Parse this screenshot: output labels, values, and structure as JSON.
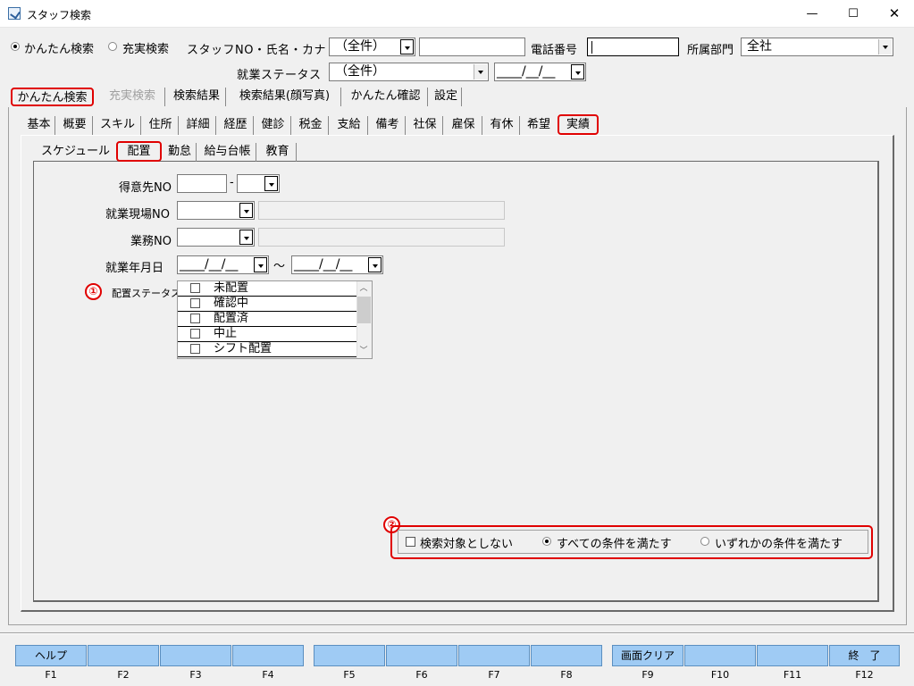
{
  "window": {
    "title": "スタッフ検索",
    "min": "—",
    "max": "☐",
    "close": "✕"
  },
  "search_mode": {
    "simple_label": "かんたん検索",
    "full_label": "充実検索",
    "selected": "simple"
  },
  "header": {
    "staff_label": "スタッフNO・氏名・カナ",
    "staff_select_value": "（全件）",
    "staff_text_value": "",
    "phone_label": "電話番号",
    "phone_value": "",
    "dept_label": "所属部門",
    "dept_value": "全社",
    "work_status_label": "就業ステータス",
    "work_status_value": "（全件）",
    "work_status_date": "____/__/__"
  },
  "main_tabs": [
    {
      "label": "かんたん検索",
      "highlighted": true
    },
    {
      "label": "充実検索",
      "disabled": true
    },
    {
      "label": "検索結果"
    },
    {
      "label": "検索結果(顔写真)"
    },
    {
      "label": "かんたん確認"
    },
    {
      "label": "設定"
    }
  ],
  "sub_tabs": [
    "基本",
    "概要",
    "スキル",
    "住所",
    "詳細",
    "経歴",
    "健診",
    "税金",
    "支給",
    "備考",
    "社保",
    "雇保",
    "有休",
    "希望",
    "実績"
  ],
  "sub_tab_selected": "実績",
  "inner_tabs": [
    "スケジュール",
    "配置",
    "勤怠",
    "給与台帳",
    "教育"
  ],
  "inner_tab_selected": "配置",
  "form": {
    "client_label": "得意先NO",
    "client_value": "",
    "client_sep": "-",
    "client_sub_value": "",
    "site_label": "就業現場NO",
    "site_value": "",
    "site_name": "",
    "job_label": "業務NO",
    "job_value": "",
    "job_name": "",
    "date_label": "就業年月日",
    "date_from": "____/__/__",
    "date_tilde": "～",
    "date_to": "____/__/__",
    "status_label": "配置ステータス",
    "status_items": [
      "未配置",
      "確認中",
      "配置済",
      "中止",
      "シフト配置"
    ]
  },
  "markers": {
    "one": "①",
    "two": "②"
  },
  "conditions": {
    "exclude_label": "検索対象としない",
    "all_label": "すべての条件を満たす",
    "any_label": "いずれかの条件を満たす",
    "selected": "all"
  },
  "function_keys": [
    {
      "key": "F1",
      "label": "ヘルプ"
    },
    {
      "key": "F2",
      "label": ""
    },
    {
      "key": "F3",
      "label": ""
    },
    {
      "key": "F4",
      "label": ""
    },
    {
      "key": "F5",
      "label": ""
    },
    {
      "key": "F6",
      "label": ""
    },
    {
      "key": "F7",
      "label": ""
    },
    {
      "key": "F8",
      "label": ""
    },
    {
      "key": "F9",
      "label": "画面クリア"
    },
    {
      "key": "F10",
      "label": ""
    },
    {
      "key": "F11",
      "label": ""
    },
    {
      "key": "F12",
      "label": "終　了"
    }
  ],
  "colors": {
    "highlight": "#e00000",
    "fkey_bg": "#9fcbf4"
  }
}
